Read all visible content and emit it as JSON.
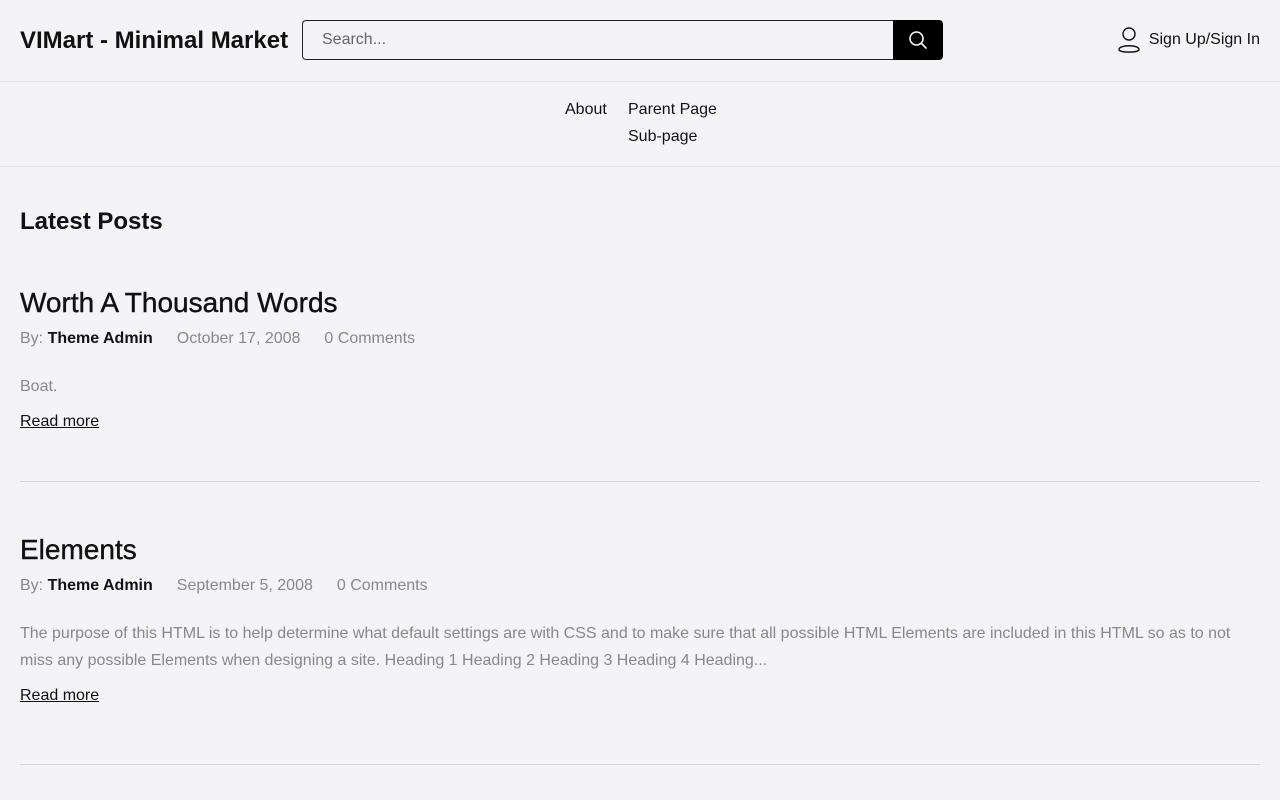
{
  "header": {
    "site_title": "VIMart - Minimal Market",
    "search_placeholder": "Search...",
    "account_label": "Sign Up/Sign In"
  },
  "nav": {
    "items": [
      {
        "label": "About"
      },
      {
        "label": "Parent Page"
      },
      {
        "label": "Sub-page"
      }
    ]
  },
  "main": {
    "section_title": "Latest Posts",
    "posts": [
      {
        "title": "Worth A Thousand Words",
        "by_label": "By:",
        "author": "Theme Admin",
        "date": "October 17, 2008",
        "comments": "0 Comments",
        "excerpt": "Boat.",
        "read_more": "Read more"
      },
      {
        "title": "Elements",
        "by_label": "By:",
        "author": "Theme Admin",
        "date": "September 5, 2008",
        "comments": "0 Comments",
        "excerpt": "The purpose of this HTML is to help determine what default settings are with CSS and to make sure that all possible HTML Elements are included in this HTML so as to not miss any possible Elements when designing a site. Heading 1 Heading 2 Heading 3 Heading 4 Heading...",
        "read_more": "Read more"
      }
    ]
  },
  "icons": {
    "search": "search-icon",
    "user": "user-icon"
  }
}
